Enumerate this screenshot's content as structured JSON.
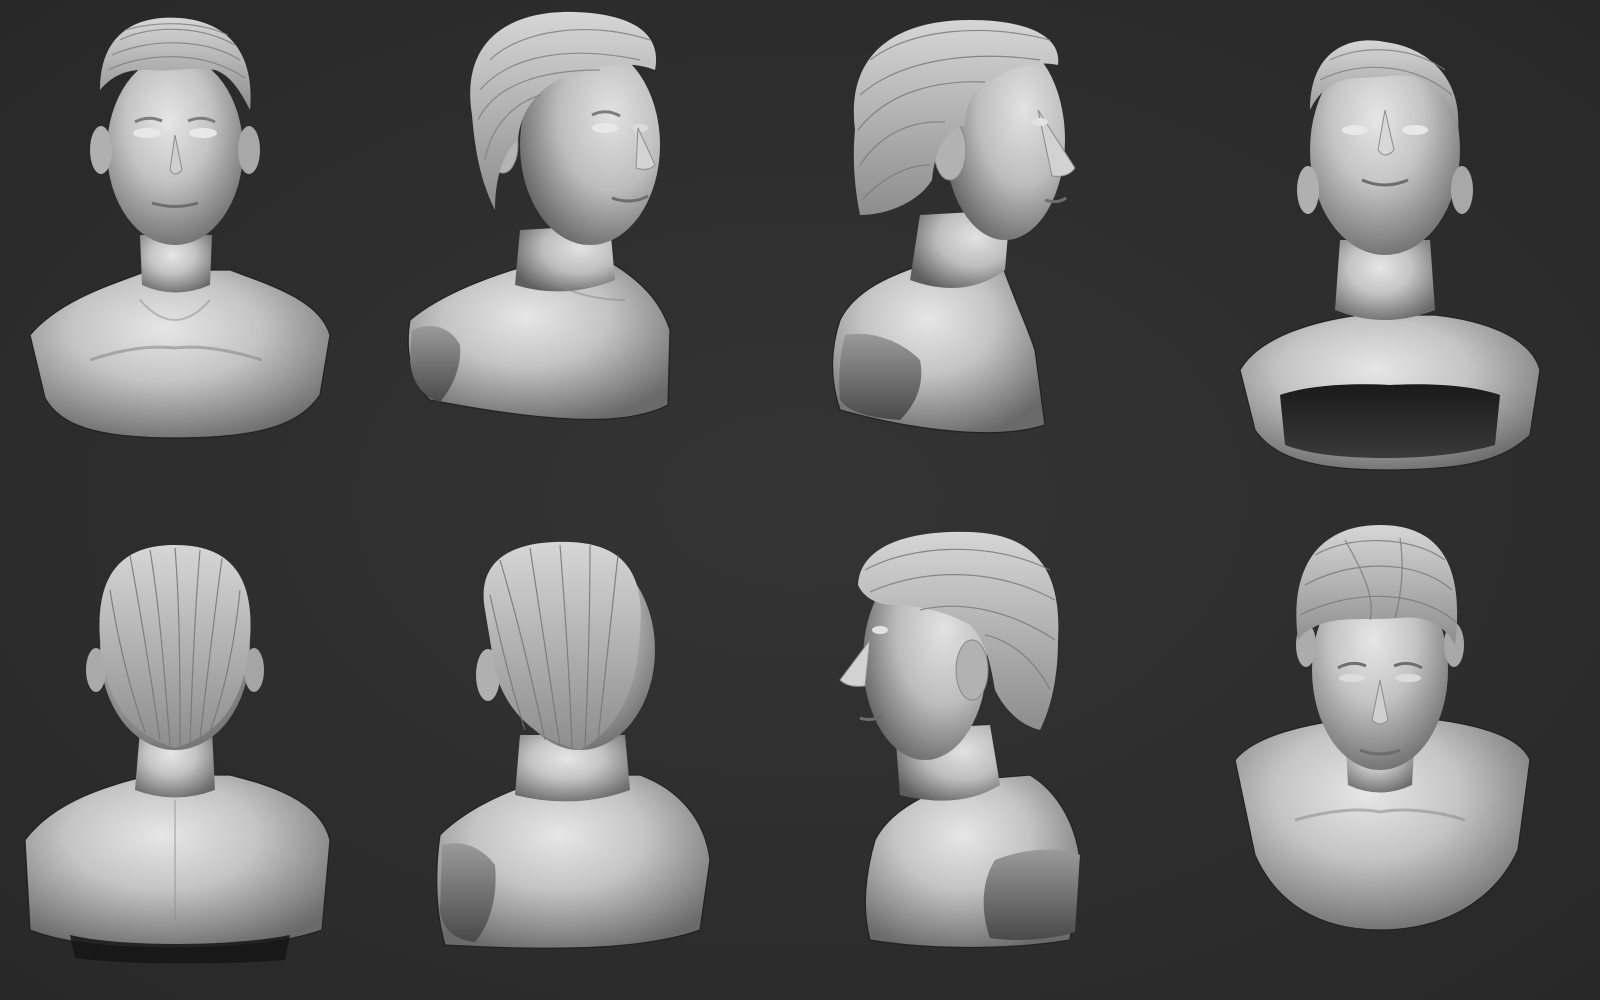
{
  "scene": {
    "background_color": "#2e2e2e",
    "material_color": "#b9b9b9",
    "views": [
      {
        "name": "front",
        "label": ""
      },
      {
        "name": "three-quarter-right",
        "label": ""
      },
      {
        "name": "profile-right",
        "label": ""
      },
      {
        "name": "low-angle-front",
        "label": ""
      },
      {
        "name": "back",
        "label": ""
      },
      {
        "name": "three-quarter-back",
        "label": ""
      },
      {
        "name": "profile-left",
        "label": ""
      },
      {
        "name": "high-angle-front",
        "label": ""
      }
    ]
  }
}
